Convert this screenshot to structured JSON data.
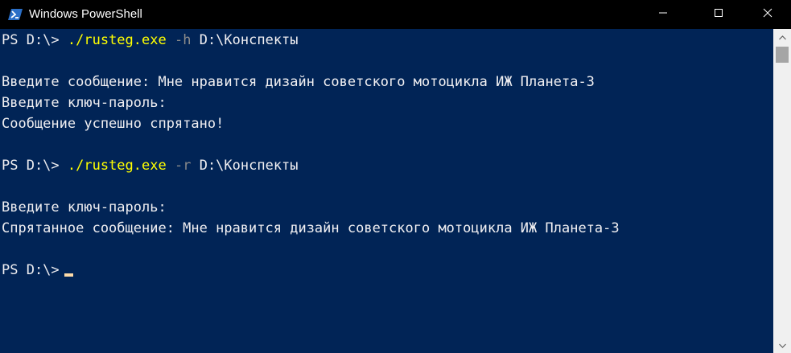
{
  "window": {
    "title": "Windows PowerShell",
    "icon": "powershell-icon"
  },
  "window_controls": {
    "minimize_icon": "minimize-icon",
    "maximize_icon": "maximize-icon",
    "close_icon": "close-icon"
  },
  "colors": {
    "console_background": "#012456",
    "console_text": "#eeedf0",
    "command_text": "#ffff00",
    "parameter_text": "#8a8a8a",
    "cursor": "#fedba9",
    "titlebar": "#000000"
  },
  "console": {
    "cmd1": {
      "prompt": "PS D:\\> ",
      "command": "./rusteg.exe",
      "space1": " ",
      "flag": "-h",
      "space2": " ",
      "argument": "D:\\Конспекты"
    },
    "out1": [
      "Введите сообщение: Мне нравится дизайн советского мотоцикла ИЖ Планета-3",
      "Введите ключ-пароль:",
      "Сообщение успешно спрятано!"
    ],
    "cmd2": {
      "prompt": "PS D:\\> ",
      "command": "./rusteg.exe",
      "space1": " ",
      "flag": "-r",
      "space2": " ",
      "argument": "D:\\Конспекты"
    },
    "out2": [
      "Введите ключ-пароль:",
      "Спрятанное сообщение: Мне нравится дизайн советского мотоцикла ИЖ Планета-3"
    ],
    "final_prompt": "PS D:\\>"
  },
  "scrollbar": {
    "up_icon": "scroll-up-arrow-icon",
    "down_icon": "scroll-down-arrow-icon"
  }
}
